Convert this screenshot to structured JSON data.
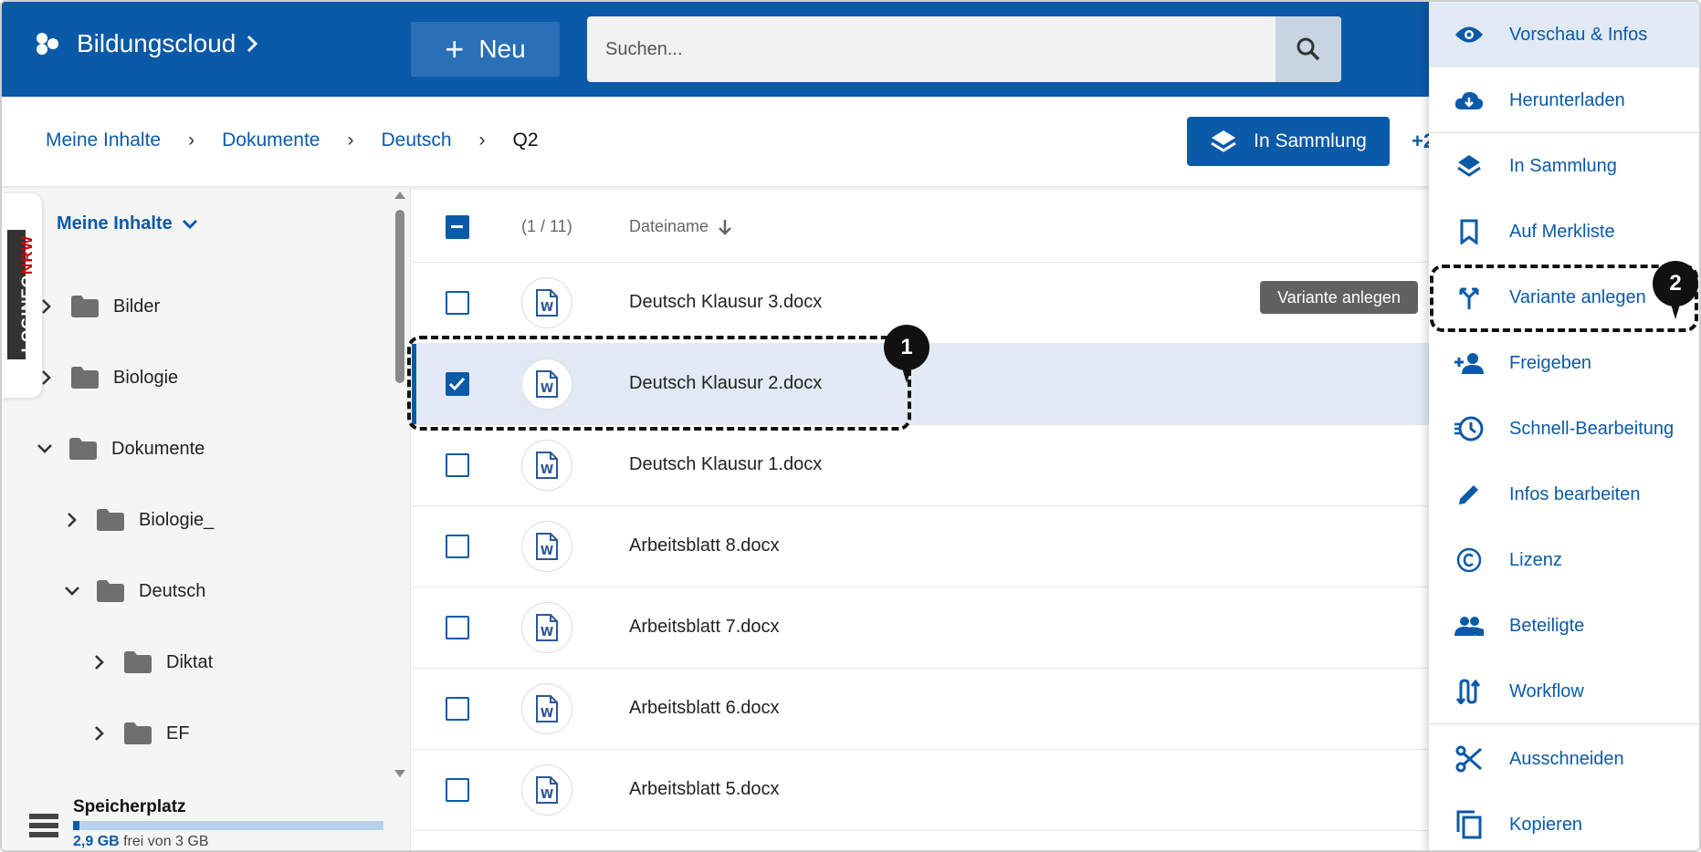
{
  "header": {
    "brand": "Bildungscloud",
    "new_label": "Neu",
    "search_placeholder": "Suchen..."
  },
  "breadcrumb": {
    "items": [
      "Meine Inhalte",
      "Dokumente",
      "Deutsch"
    ],
    "current": "Q2"
  },
  "toolbar": {
    "collection_label": "In Sammlung",
    "share_peek": "+2"
  },
  "sidebar": {
    "badge": "LOGINEO",
    "badge_nrw": "NRW",
    "title": "Meine Inhalte",
    "tree": [
      "Bilder",
      "Biologie",
      "Dokumente",
      "Biologie_",
      "Deutsch",
      "Diktat",
      "EF"
    ],
    "storage": {
      "label": "Speicherplatz",
      "used": "2,9 GB",
      "rest": " frei von 3 GB",
      "fill_fraction": 0.02
    }
  },
  "list": {
    "count": "(1 / 11)",
    "column_name": "Dateiname",
    "files": [
      "Deutsch Klausur 3.docx",
      "Deutsch Klausur 2.docx",
      "Deutsch Klausur 1.docx",
      "Arbeitsblatt 8.docx",
      "Arbeitsblatt 7.docx",
      "Arbeitsblatt 6.docx",
      "Arbeitsblatt 5.docx"
    ],
    "selected_index": 1
  },
  "tooltip": "Variante anlegen",
  "menu": {
    "items": [
      "Vorschau & Infos",
      "Herunterladen",
      "In Sammlung",
      "Auf Merkliste",
      "Variante anlegen",
      "Freigeben",
      "Schnell-Bearbeitung",
      "Infos bearbeiten",
      "Lizenz",
      "Beteiligte",
      "Workflow",
      "Ausschneiden",
      "Kopieren"
    ]
  },
  "markers": [
    "1",
    "2"
  ],
  "colors": {
    "primary": "#0b5aa8",
    "selected_row": "#e1eaf4"
  }
}
